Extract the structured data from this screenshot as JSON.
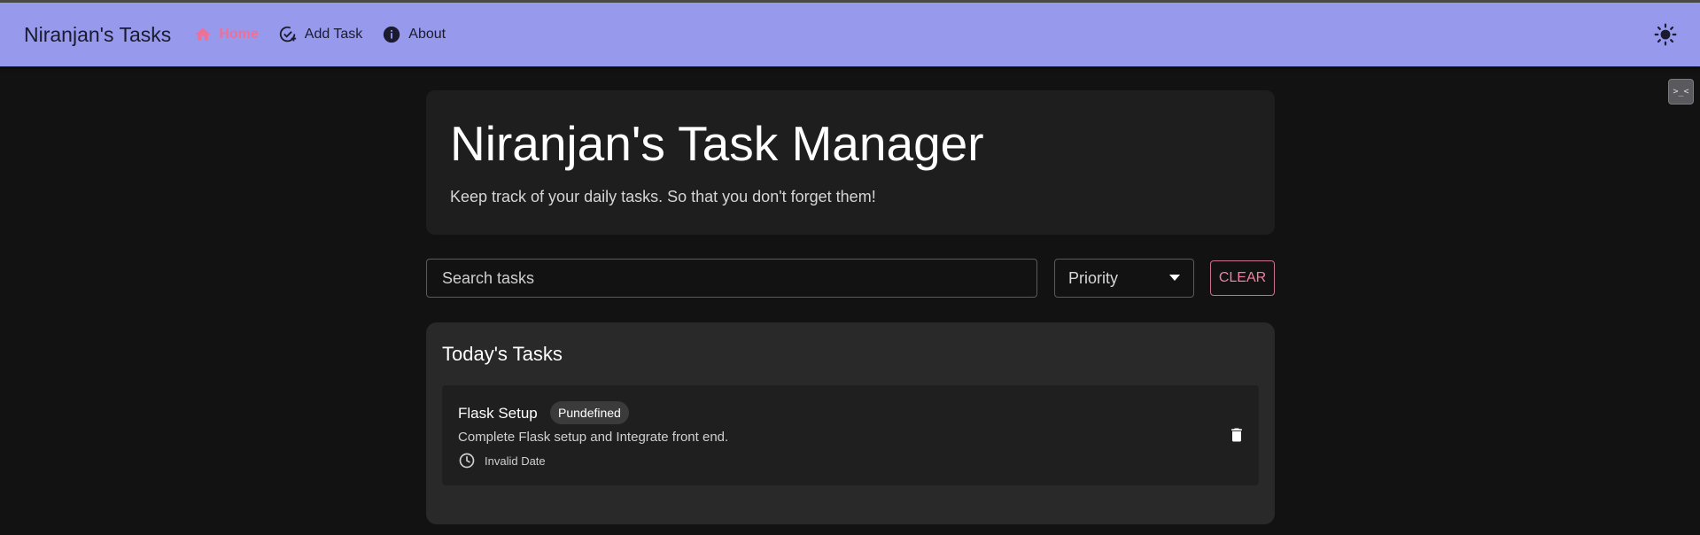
{
  "nav": {
    "brand": "Niranjan's Tasks",
    "items": [
      {
        "label": "Home",
        "icon": "home-icon",
        "active": true
      },
      {
        "label": "Add Task",
        "icon": "add-task-icon"
      },
      {
        "label": "About",
        "icon": "info-icon"
      }
    ],
    "theme_toggle_icon": "sun-icon"
  },
  "extension_icon_text": ">_<",
  "hero": {
    "title": "Niranjan's Task Manager",
    "subtitle": "Keep track of your daily tasks. So that you don't forget them!"
  },
  "filters": {
    "search_placeholder": "Search tasks",
    "priority_label": "Priority",
    "clear_label": "CLEAR"
  },
  "tasks_section": {
    "title": "Today's Tasks",
    "tasks": [
      {
        "name": "Flask Setup",
        "badge": "Pundefined",
        "description": "Complete Flask setup and Integrate front end.",
        "date": "Invalid Date"
      }
    ]
  },
  "colors": {
    "navbar": "#9699ec",
    "accent_pink": "#f06f97",
    "background": "#121212",
    "panel": "#292929",
    "card": "#1f1f1f"
  }
}
